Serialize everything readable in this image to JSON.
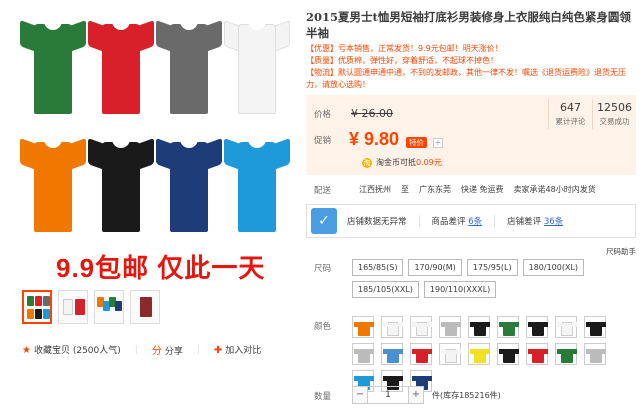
{
  "product": {
    "title": "2015夏男士t恤男短袖打底衫男装修身上衣服纯白纯色紧身圆领半袖",
    "promo_lines": [
      "【优惠】亏本销售，正常发货！9.9元包邮！明天涨价！",
      "【质量】优质棉，弹性好，穿着舒适，不起球不掉色！",
      "【物流】默认圆通申通中通，不到的发邮政，其他一律不发！嘱选《退货运费险》退货无压力，请放心选购！"
    ],
    "promo_banner": "9.9包邮 仅此一天"
  },
  "colors": {
    "accent": "#ff4400",
    "price_bg": "#fff2e8",
    "promo_red": "#e4160e"
  },
  "main_shirts": [
    {
      "color": "#2a7a3a"
    },
    {
      "color": "#d8202a"
    },
    {
      "color": "#6a6a6a"
    },
    {
      "color": "#f4f4f4"
    },
    {
      "color": "#f07800"
    },
    {
      "color": "#1a1a1a"
    },
    {
      "color": "#1e3c78"
    },
    {
      "color": "#1e9ad8"
    }
  ],
  "price": {
    "label": "价格",
    "original": "¥ 26.00",
    "promo_label": "促销",
    "current": "¥ 9.80",
    "tag": "特价",
    "coin_icon": "淘",
    "coin_text": "淘金币可抵",
    "coin_amount": "0.09元",
    "reviews_count": "647",
    "reviews_label": "累计评论",
    "sales_count": "12506",
    "sales_label": "交易成功"
  },
  "shipping": {
    "label": "配送",
    "from": "江西抚州",
    "to_label": "至",
    "to": "广东东莞",
    "express": "快递 免运费",
    "promise": "卖家承诺48小时内发货"
  },
  "shop_rating": {
    "icon": "shop-rating-icon",
    "label": "店铺数据无异常",
    "goods_label": "商品差评",
    "goods_value": "6条",
    "shop_label": "店铺差评",
    "shop_value": "36条"
  },
  "size_helper": "尺码助手",
  "size": {
    "label": "尺码",
    "options": [
      "165/85(S)",
      "170/90(M)",
      "175/95(L)",
      "180/100(XL)",
      "185/105(XXL)",
      "190/110(XXXL)"
    ]
  },
  "color_section": {
    "label": "颜色",
    "swatches": [
      "#f07800",
      "#f4f4f4",
      "#f4f4f4",
      "#bbbbbb",
      "#1a1a1a",
      "#2a7a3a",
      "#1a1a1a",
      "#f4f4f4",
      "#1a1a1a",
      "#bbbbbb",
      "#4a90d0",
      "#d8202a",
      "#f4f4f4",
      "#f0e020",
      "#1a1a1a",
      "#d8202a",
      "#2a7a3a",
      "#bbbbbb",
      "#1e9ad8",
      "#1a1a1a",
      "#1e3c78"
    ]
  },
  "quantity": {
    "label": "数量",
    "minus": "−",
    "value": "1",
    "plus": "+",
    "stock": "件(库存185216件)"
  },
  "actions": {
    "favorite_icon": "★",
    "favorite": "收藏宝贝 (2500人气)",
    "share_icon": "分",
    "share": "分享",
    "compare_icon": "✚",
    "compare": "加入对比"
  }
}
